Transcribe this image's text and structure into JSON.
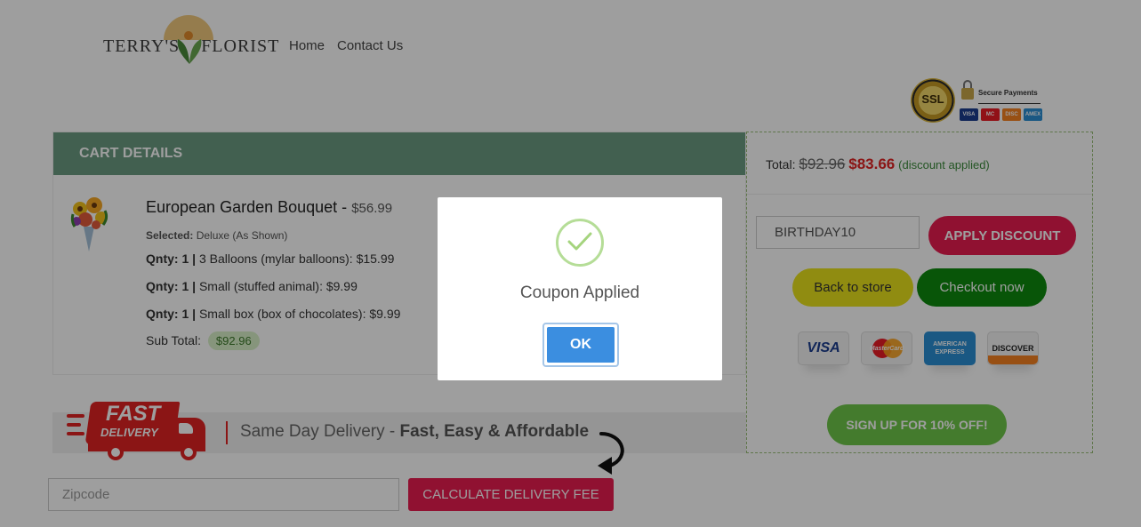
{
  "header": {
    "logo_text_left": "TERRY'S",
    "logo_text_right": "FLORIST",
    "nav": [
      {
        "label": "Home"
      },
      {
        "label": "Contact Us"
      }
    ],
    "security": {
      "seal_text": "SSL",
      "label": "Secure Payments",
      "mini_cards": [
        "VISA",
        "MC",
        "DISC",
        "AMEX"
      ]
    }
  },
  "cart": {
    "title": "CART DETAILS",
    "item": {
      "name": "European Garden Bouquet -",
      "price": "$56.99",
      "selected_label": "Selected:",
      "selected_value": "Deluxe (As Shown)"
    },
    "addons": [
      {
        "qty_label": "Qnty: 1 |",
        "desc": "3 Balloons (mylar balloons):",
        "price": "$15.99"
      },
      {
        "qty_label": "Qnty: 1 |",
        "desc": "Small (stuffed animal):",
        "price": "$9.99"
      },
      {
        "qty_label": "Qnty: 1 |",
        "desc": "Small box (box of chocolates):",
        "price": "$9.99"
      }
    ],
    "subtotal_label": "Sub Total:",
    "subtotal_value": "$92.96"
  },
  "delivery": {
    "badge_fast": "FAST",
    "badge_delivery": "DELIVERY",
    "text_plain": "Same Day Delivery -",
    "text_bold": "Fast, Easy & Affordable",
    "zipcode_placeholder": "Zipcode",
    "calc_button": "CALCULATE DELIVERY FEE"
  },
  "summary": {
    "total_label": "Total:",
    "old_total": "$92.96",
    "new_total": "$83.66",
    "discount_note": "(discount applied)",
    "coupon_value": "BIRTHDAY10",
    "apply_button": "APPLY DISCOUNT",
    "back_button": "Back to store",
    "checkout_button": "Checkout now",
    "cards": {
      "visa": "VISA",
      "mastercard": "MasterCard",
      "amex_line1": "AMERICAN",
      "amex_line2": "EXPRESS",
      "discover": "DISCOVER"
    },
    "signup_button": "SIGN UP FOR 10% OFF!"
  },
  "modal": {
    "title": "Coupon Applied",
    "ok_button": "OK"
  },
  "colors": {
    "header_green": "#6b9c82",
    "primary_red": "#e81c4f",
    "price_red": "#e02323",
    "checkout_green": "#0e8a0e",
    "back_yellow": "#e8e21c",
    "signup_green": "#6fc74a",
    "ok_blue": "#3b8ee0"
  }
}
